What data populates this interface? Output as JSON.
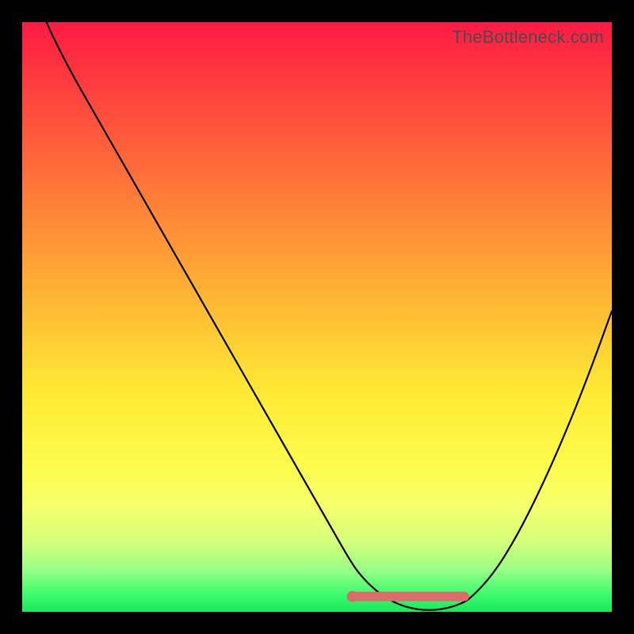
{
  "watermark": "TheBottleneck.com",
  "colors": {
    "gradient_top": "#ff1a44",
    "gradient_bottom": "#18e85b",
    "curve": "#000000",
    "highlight": "#dd6b6b",
    "frame": "#000000"
  },
  "chart_data": {
    "type": "line",
    "title": "",
    "xlabel": "",
    "ylabel": "",
    "xlim": [
      0,
      100
    ],
    "ylim": [
      0,
      100
    ],
    "grid": false,
    "legend": false,
    "series": [
      {
        "name": "bottleneck-curve",
        "x": [
          0,
          4,
          8,
          12,
          16,
          20,
          24,
          28,
          32,
          36,
          40,
          44,
          48,
          52,
          56,
          58,
          60,
          62,
          64,
          66,
          68,
          70,
          72,
          74,
          76,
          80,
          84,
          88,
          92,
          96,
          100
        ],
        "y": [
          110,
          100,
          92,
          85,
          78,
          71,
          64,
          57,
          50,
          43,
          36,
          29,
          22,
          15,
          8,
          5.5,
          3.6,
          2.2,
          1.2,
          0.6,
          0.3,
          0.3,
          0.6,
          1.2,
          2.2,
          6.5,
          13,
          21,
          30,
          40,
          51
        ]
      }
    ],
    "highlight_range": {
      "name": "optimal-range",
      "x_start": 56,
      "x_end": 75,
      "y": 2.6
    },
    "highlight_point": {
      "name": "optimal-start-dot",
      "x": 56,
      "y": 2.6
    }
  }
}
